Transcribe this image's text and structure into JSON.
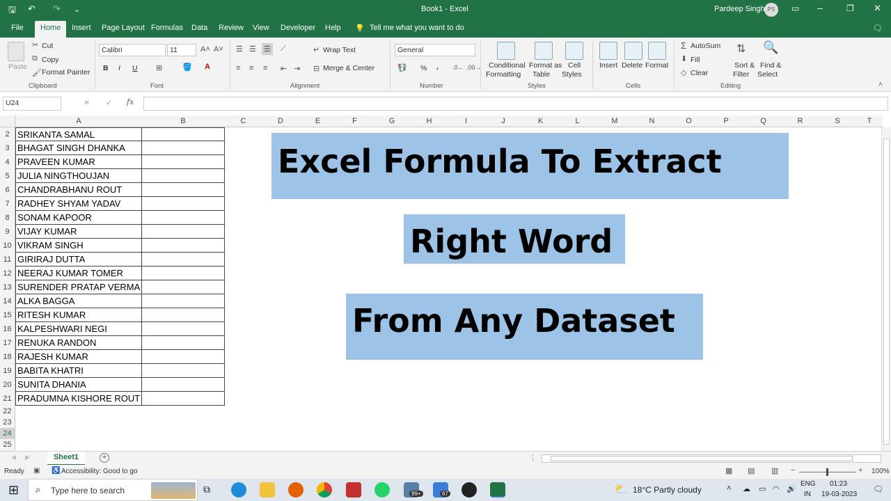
{
  "window": {
    "title": "Book1 - Excel",
    "user": "Pardeep Singh",
    "user_initials": "PS"
  },
  "tabs": [
    "File",
    "Home",
    "Insert",
    "Page Layout",
    "Formulas",
    "Data",
    "Review",
    "View",
    "Developer",
    "Help"
  ],
  "tell_me": "Tell me what you want to do",
  "ribbon": {
    "clipboard": {
      "paste": "Paste",
      "cut": "Cut",
      "copy": "Copy",
      "format_painter": "Format Painter",
      "group": "Clipboard"
    },
    "font": {
      "name": "Calibri",
      "size": "11",
      "group": "Font",
      "bold": "B",
      "italic": "I",
      "underline": "U"
    },
    "alignment": {
      "wrap": "Wrap Text",
      "merge": "Merge & Center",
      "group": "Alignment"
    },
    "number": {
      "format": "General",
      "group": "Number",
      "percent": "%",
      "comma": ","
    },
    "styles": {
      "conditional": "Conditional",
      "conditional2": "Formatting",
      "format_table": "Format as",
      "format_table2": "Table",
      "cell_styles": "Cell",
      "cell_styles2": "Styles",
      "group": "Styles"
    },
    "cells": {
      "insert": "Insert",
      "delete": "Delete",
      "format": "Format",
      "group": "Cells"
    },
    "editing": {
      "autosum": "AutoSum",
      "fill": "Fill",
      "clear": "Clear",
      "sort": "Sort &",
      "sort2": "Filter",
      "find": "Find &",
      "find2": "Select",
      "group": "Editing"
    }
  },
  "formula_bar": {
    "name_box": "U24",
    "fx": "fx",
    "value": ""
  },
  "columns": [
    "A",
    "B",
    "C",
    "D",
    "E",
    "F",
    "G",
    "H",
    "I",
    "J",
    "K",
    "L",
    "M",
    "N",
    "O",
    "P",
    "Q",
    "R",
    "S",
    "T"
  ],
  "rows": [
    {
      "n": "2",
      "a": "SRIKANTA SAMAL"
    },
    {
      "n": "3",
      "a": "BHAGAT SINGH DHANKA"
    },
    {
      "n": "4",
      "a": "PRAVEEN KUMAR"
    },
    {
      "n": "5",
      "a": "JULIA NINGTHOUJAN"
    },
    {
      "n": "6",
      "a": "CHANDRABHANU ROUT"
    },
    {
      "n": "7",
      "a": "RADHEY SHYAM YADAV"
    },
    {
      "n": "8",
      "a": "SONAM KAPOOR"
    },
    {
      "n": "9",
      "a": "VIJAY KUMAR"
    },
    {
      "n": "10",
      "a": "VIKRAM SINGH"
    },
    {
      "n": "11",
      "a": "GIRIRAJ DUTTA"
    },
    {
      "n": "12",
      "a": "NEERAJ KUMAR TOMER"
    },
    {
      "n": "13",
      "a": "SURENDER PRATAP VERMA"
    },
    {
      "n": "14",
      "a": "ALKA BAGGA"
    },
    {
      "n": "15",
      "a": "RITESH KUMAR"
    },
    {
      "n": "16",
      "a": "KALPESHWARI NEGI"
    },
    {
      "n": "17",
      "a": "RENUKA RANDON"
    },
    {
      "n": "18",
      "a": "RAJESH KUMAR"
    },
    {
      "n": "19",
      "a": "BABITA KHATRI"
    },
    {
      "n": "20",
      "a": "SUNITA DHANIA"
    },
    {
      "n": "21",
      "a": "PRADUMNA KISHORE ROUT"
    }
  ],
  "empty_rows": [
    "22",
    "23",
    "24",
    "25"
  ],
  "banners": {
    "line1": "Excel Formula To Extract",
    "line2": "Right Word",
    "line3": "From Any Dataset"
  },
  "sheet_tab": "Sheet1",
  "status": {
    "ready": "Ready",
    "accessibility": "Accessibility: Good to go",
    "zoom": "100%"
  },
  "taskbar": {
    "search": "Type here to search",
    "weather": "18°C  Partly cloudy",
    "lang1": "ENG",
    "lang2": "IN",
    "time": "01:23",
    "date": "19-03-2023",
    "mail_badge": "99+",
    "store_badge": "67"
  }
}
